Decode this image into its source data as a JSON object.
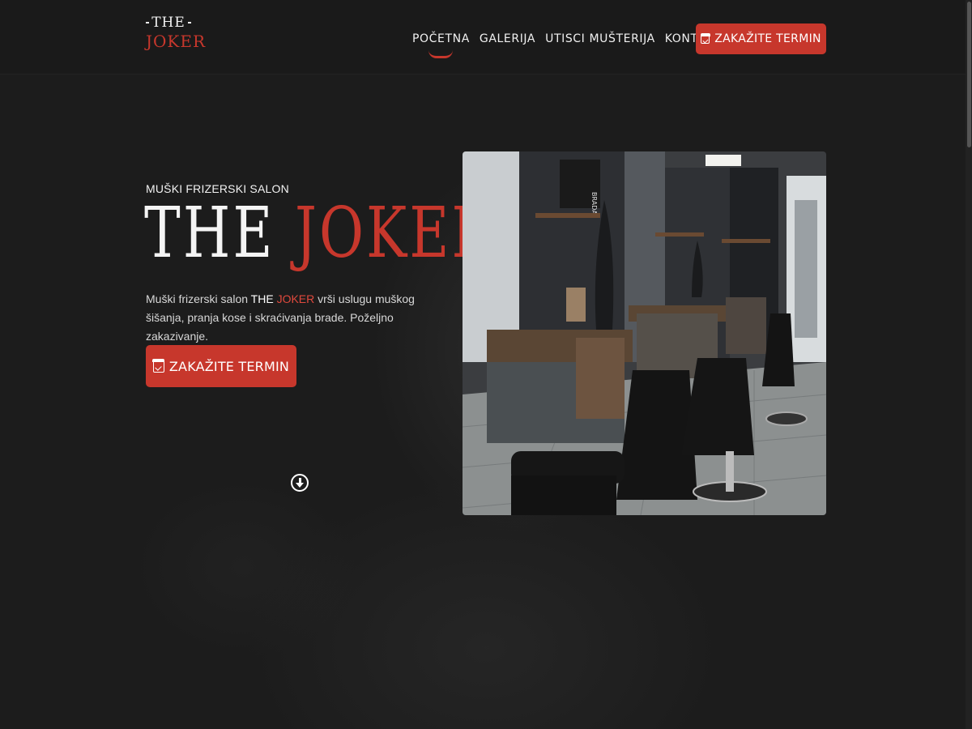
{
  "header": {
    "logo": {
      "line1": "THE",
      "line2": "JOKER"
    },
    "nav": [
      {
        "label": "POČETNA",
        "active": true
      },
      {
        "label": "GALERIJA",
        "active": false
      },
      {
        "label": "UTISCI MUŠTERIJA",
        "active": false
      },
      {
        "label": "KONTAKT",
        "active": false
      }
    ],
    "cta_label": "ZAKAŽITE TERMIN"
  },
  "hero": {
    "subtitle": "MUŠKI FRIZERSKI SALON",
    "title_part1": "THE",
    "title_part2": "JOKER",
    "desc_start": "Muški frizerski salon ",
    "desc_brand1": "THE",
    "desc_brand2": "JOKER",
    "desc_end": " vrši uslugu muškog šišanja, pranja kose i skraćivanja brade. Poželjno zakazivanje.",
    "cta_label": "ZAKAŽITE TERMIN",
    "photo_sign": "BRADA"
  },
  "colors": {
    "accent": "#c7372c",
    "background": "#1b1b1b",
    "text": "#f2f2f2"
  },
  "icons": {
    "calendar": "calendar-check-icon",
    "scroll": "arrow-circle-down-icon"
  }
}
